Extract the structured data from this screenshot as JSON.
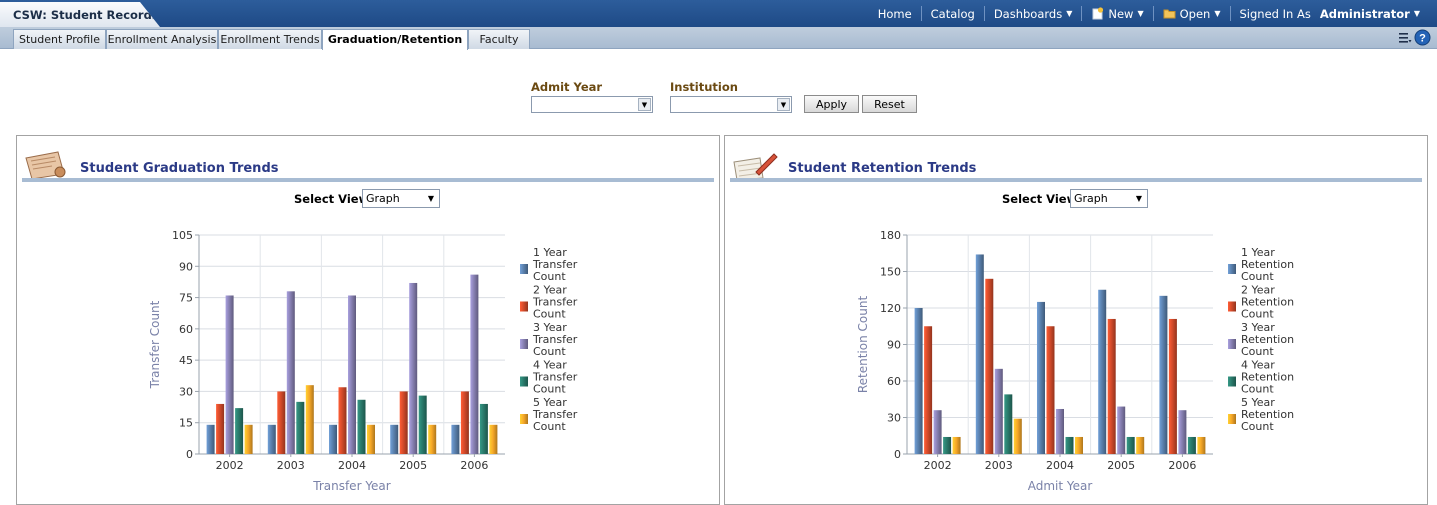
{
  "app": {
    "title": "CSW: Student Records"
  },
  "topnav": {
    "home": "Home",
    "catalog": "Catalog",
    "dashboards": "Dashboards",
    "new": "New",
    "open": "Open",
    "signed_in_as": "Signed In As",
    "user": "Administrator"
  },
  "tabs": [
    {
      "label": "Student Profile"
    },
    {
      "label": "Enrollment Analysis"
    },
    {
      "label": "Enrollment Trends"
    },
    {
      "label": "Graduation/Retention",
      "active": true
    },
    {
      "label": "Faculty"
    }
  ],
  "prompts": {
    "admit_year_label": "Admit Year",
    "admit_year_value": "",
    "institution_label": "Institution",
    "institution_value": "",
    "apply_label": "Apply",
    "reset_label": "Reset"
  },
  "panels": {
    "graduation": {
      "title": "Student Graduation Trends",
      "select_view_label": "Select View",
      "select_view_value": "Graph"
    },
    "retention": {
      "title": "Student Retention Trends",
      "select_view_label": "Select View",
      "select_view_value": "Graph"
    }
  },
  "colors": {
    "series": [
      "#5a80ad",
      "#d24a2a",
      "#8780b2",
      "#2a7a6b",
      "#f7a828"
    ],
    "accent": "#2b3a86",
    "topbar": "#25528f"
  },
  "chart_data": [
    {
      "type": "bar",
      "title": "",
      "xlabel": "Transfer Year",
      "ylabel": "Transfer Count",
      "categories": [
        "2002",
        "2003",
        "2004",
        "2005",
        "2006"
      ],
      "ylim": [
        0,
        105
      ],
      "yticks": [
        0,
        15,
        30,
        45,
        60,
        75,
        90,
        105
      ],
      "grid": true,
      "legend": "right",
      "series": [
        {
          "name": "1 Year Transfer Count",
          "values": [
            14,
            14,
            14,
            14,
            14
          ]
        },
        {
          "name": "2 Year Transfer Count",
          "values": [
            24,
            30,
            32,
            30,
            30
          ]
        },
        {
          "name": "3 Year Transfer Count",
          "values": [
            76,
            78,
            76,
            82,
            86
          ]
        },
        {
          "name": "4 Year Transfer Count",
          "values": [
            22,
            25,
            26,
            28,
            24
          ]
        },
        {
          "name": "5 Year Transfer Count",
          "values": [
            14,
            33,
            14,
            14,
            14
          ]
        }
      ]
    },
    {
      "type": "bar",
      "title": "",
      "xlabel": "Admit Year",
      "ylabel": "Retention Count",
      "categories": [
        "2002",
        "2003",
        "2004",
        "2005",
        "2006"
      ],
      "ylim": [
        0,
        180
      ],
      "yticks": [
        0,
        30,
        60,
        90,
        120,
        150,
        180
      ],
      "grid": true,
      "legend": "right",
      "series": [
        {
          "name": "1 Year Retention Count",
          "values": [
            120,
            164,
            125,
            135,
            130
          ]
        },
        {
          "name": "2 Year Retention Count",
          "values": [
            105,
            144,
            105,
            111,
            111
          ]
        },
        {
          "name": "3 Year Retention Count",
          "values": [
            36,
            70,
            37,
            39,
            36
          ]
        },
        {
          "name": "4 Year Retention Count",
          "values": [
            14,
            49,
            14,
            14,
            14
          ]
        },
        {
          "name": "5 Year Retention Count",
          "values": [
            14,
            29,
            14,
            14,
            14
          ]
        }
      ]
    }
  ]
}
